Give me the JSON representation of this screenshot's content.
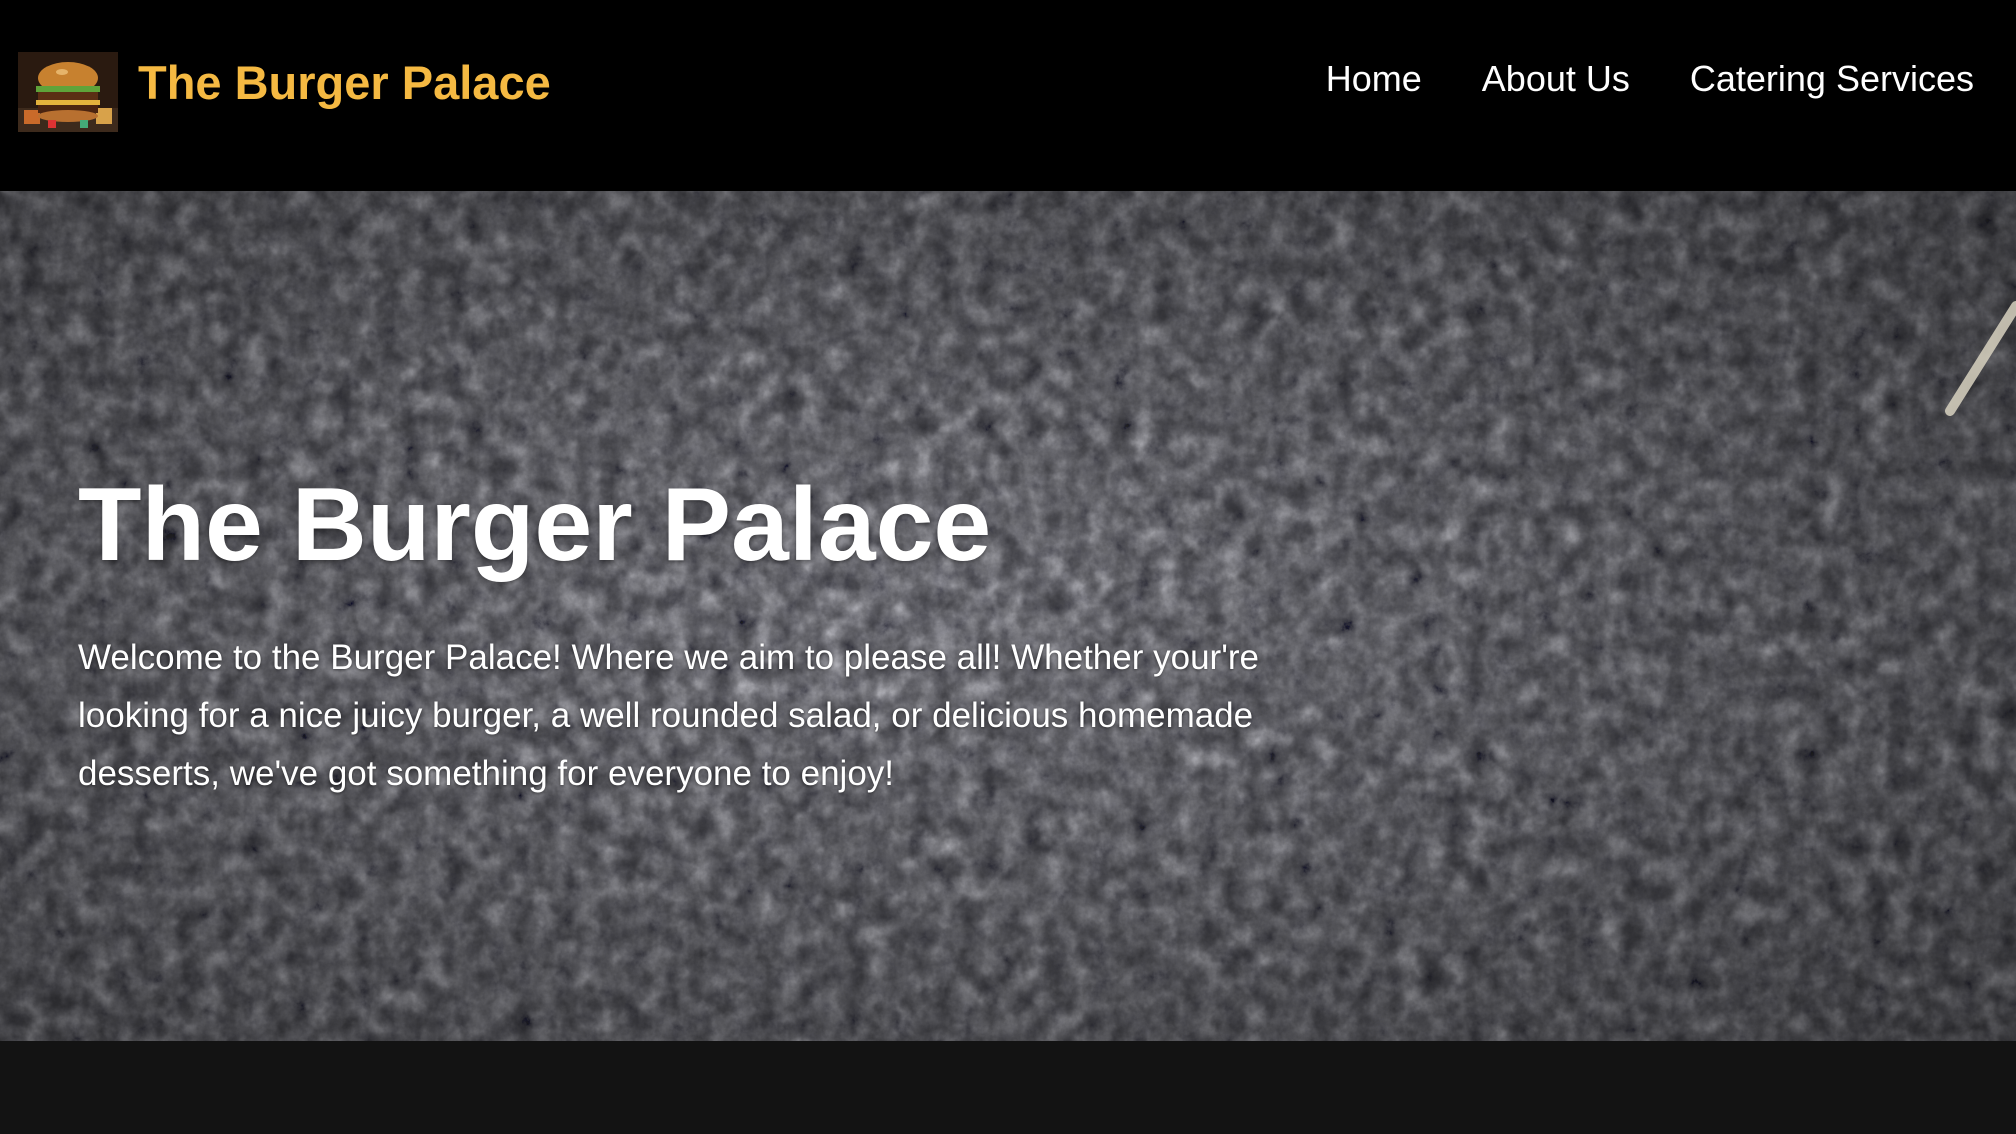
{
  "brand": {
    "name": "The Burger Palace",
    "logo_icon": "burger-photo-icon",
    "accent_color": "#f5b942"
  },
  "nav": {
    "links": [
      {
        "label": "Home"
      },
      {
        "label": "About Us"
      },
      {
        "label": "Catering Services"
      }
    ]
  },
  "hero": {
    "title": "The Burger Palace",
    "text": "Welcome to the Burger Palace! Where we aim to please all! Whether your're looking for a nice juicy burger, a well rounded salad, or delicious homemade desserts, we've got something for everyone to enjoy!",
    "background": "dark-slate-texture"
  }
}
